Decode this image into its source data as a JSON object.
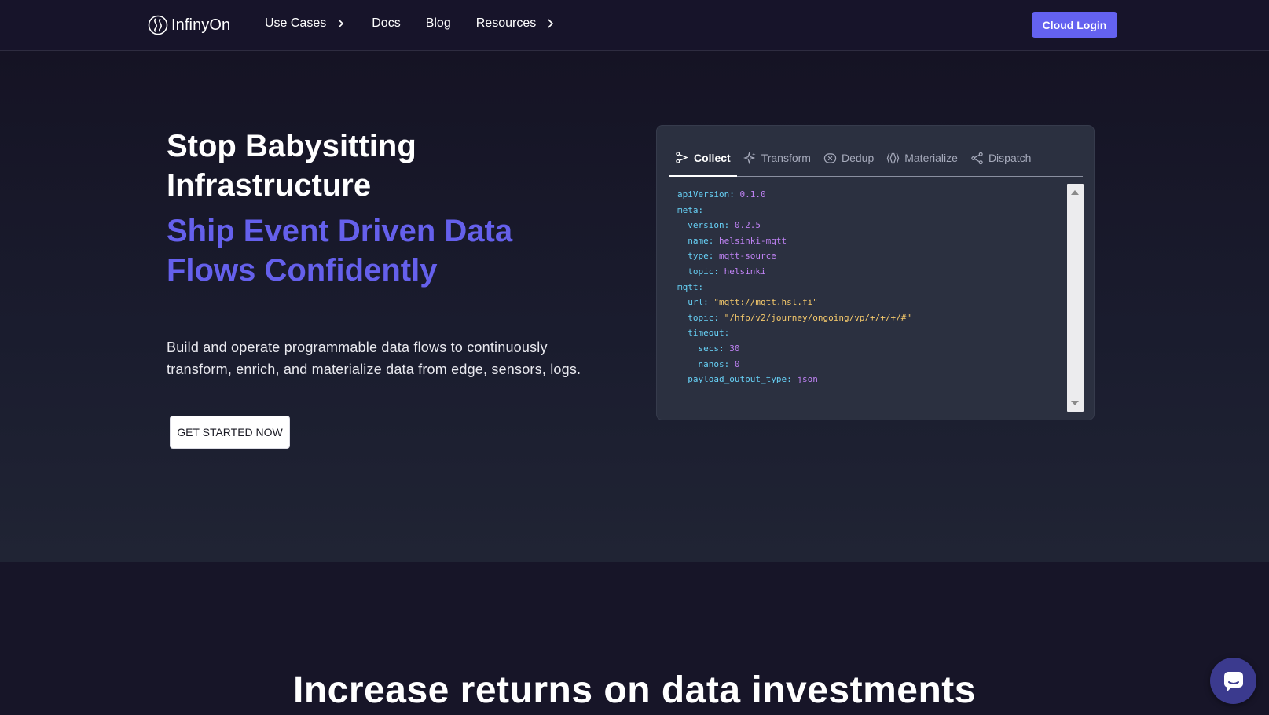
{
  "nav": {
    "logo_text": "InfinyOn",
    "links": [
      {
        "label": "Use Cases",
        "has_chevron": true
      },
      {
        "label": "Docs",
        "has_chevron": false
      },
      {
        "label": "Blog",
        "has_chevron": false
      },
      {
        "label": "Resources",
        "has_chevron": true
      }
    ],
    "cta_label": "Cloud Login"
  },
  "hero": {
    "title_line1": "Stop Babysitting",
    "title_line2": "Infrastructure",
    "subtitle_line1": "Ship Event Driven Data",
    "subtitle_line2": "Flows Confidently",
    "lede_line1": "Build and operate programmable data flows to continuously",
    "lede_line2": "transform, enrich, and materialize data from edge, sensors, logs.",
    "cta_label": "GET STARTED NOW"
  },
  "code_card": {
    "tabs": [
      {
        "label": "Collect",
        "icon": "collect-icon",
        "active": true
      },
      {
        "label": "Transform",
        "icon": "sparkle-icon",
        "active": false
      },
      {
        "label": "Dedup",
        "icon": "dedup-icon",
        "active": false
      },
      {
        "label": "Materialize",
        "icon": "materialize-icon",
        "active": false
      },
      {
        "label": "Dispatch",
        "icon": "share-icon",
        "active": false
      }
    ],
    "code_lines": [
      {
        "indent": "",
        "key": "apiVersion",
        "value": "0.1.0",
        "vtype": "n"
      },
      {
        "indent": "",
        "key": "meta",
        "value": "",
        "vtype": "n"
      },
      {
        "indent": "  ",
        "key": "version",
        "value": "0.2.5",
        "vtype": "n"
      },
      {
        "indent": "  ",
        "key": "name",
        "value": "helsinki-mqtt",
        "vtype": "n"
      },
      {
        "indent": "  ",
        "key": "type",
        "value": "mqtt-source",
        "vtype": "n"
      },
      {
        "indent": "  ",
        "key": "topic",
        "value": "helsinki",
        "vtype": "n"
      },
      {
        "indent": "",
        "key": "mqtt",
        "value": "",
        "vtype": "n"
      },
      {
        "indent": "  ",
        "key": "url",
        "value": "\"mqtt://mqtt.hsl.fi\"",
        "vtype": "s"
      },
      {
        "indent": "  ",
        "key": "topic",
        "value": "\"/hfp/v2/journey/ongoing/vp/+/+/+/#\"",
        "vtype": "s"
      },
      {
        "indent": "  ",
        "key": "timeout",
        "value": "",
        "vtype": "n"
      },
      {
        "indent": "    ",
        "key": "secs",
        "value": "30",
        "vtype": "n"
      },
      {
        "indent": "    ",
        "key": "nanos",
        "value": "0",
        "vtype": "n"
      },
      {
        "indent": "  ",
        "key": "payload_output_type",
        "value": "json",
        "vtype": "n"
      }
    ]
  },
  "section2": {
    "title": "Increase returns on data investments"
  },
  "colors": {
    "accent": "#6462f0",
    "subtitle": "#6560ec",
    "code_key": "#67d0f5",
    "code_value": "#c083f5",
    "code_string": "#f5c96b"
  }
}
